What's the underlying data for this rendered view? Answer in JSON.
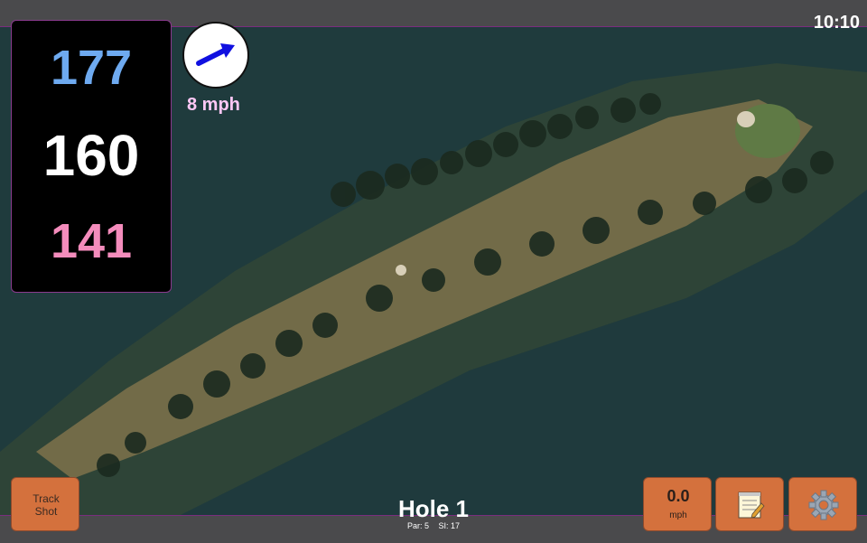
{
  "status_bar": {
    "time": "10:10"
  },
  "distances": {
    "back": "177",
    "middle": "160",
    "front": "141"
  },
  "wind": {
    "speed_label": "8 mph",
    "icon": "wind-arrow-icon",
    "direction": "north-east"
  },
  "map": {
    "icon": "course-satellite-map"
  },
  "buttons": {
    "track_shot": {
      "line1": "Track",
      "line2": "Shot"
    },
    "speed": {
      "value": "0.0",
      "unit": "mph"
    },
    "notes": {
      "icon": "notepad-icon"
    },
    "settings": {
      "icon": "gear-icon"
    }
  },
  "hole": {
    "title": "Hole 1",
    "par": "Par: 5",
    "si": "SI: 17"
  },
  "colors": {
    "back_distance": "#6eaaf0",
    "middle_distance": "#ffffff",
    "front_distance": "#f48cbc",
    "button_orange": "#d4713d",
    "accent_purple": "#7a2d7e"
  }
}
